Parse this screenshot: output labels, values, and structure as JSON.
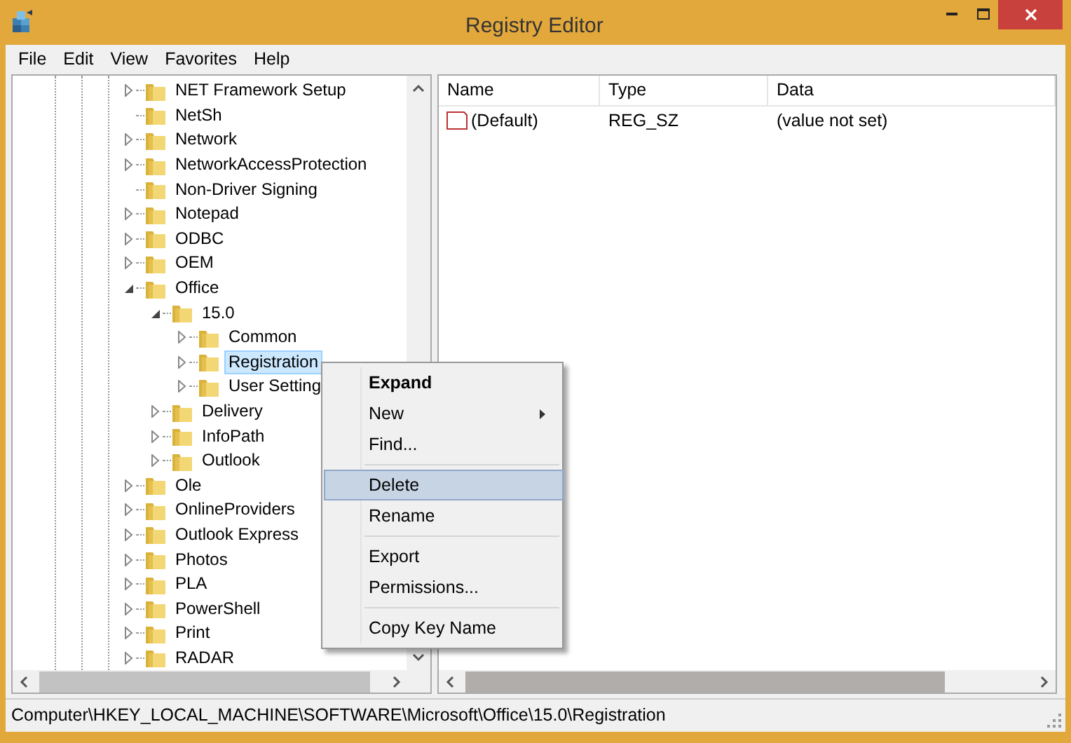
{
  "window": {
    "title": "Registry Editor"
  },
  "menu": [
    "File",
    "Edit",
    "View",
    "Favorites",
    "Help"
  ],
  "tree": [
    {
      "label": "NET Framework Setup",
      "expandable": true,
      "expanded": false,
      "selected": false
    },
    {
      "label": "NetSh",
      "expandable": false,
      "selected": false
    },
    {
      "label": "Network",
      "expandable": true,
      "expanded": false,
      "selected": false
    },
    {
      "label": "NetworkAccessProtection",
      "expandable": true,
      "expanded": false,
      "selected": false
    },
    {
      "label": "Non-Driver Signing",
      "expandable": false,
      "selected": false
    },
    {
      "label": "Notepad",
      "expandable": true,
      "expanded": false,
      "selected": false
    },
    {
      "label": "ODBC",
      "expandable": true,
      "expanded": false,
      "selected": false
    },
    {
      "label": "OEM",
      "expandable": true,
      "expanded": false,
      "selected": false
    },
    {
      "label": "Office",
      "expandable": true,
      "expanded": true,
      "selected": false,
      "children": [
        {
          "label": "15.0",
          "expandable": true,
          "expanded": true,
          "selected": false,
          "children": [
            {
              "label": "Common",
              "expandable": true,
              "expanded": false,
              "selected": false
            },
            {
              "label": "Registration",
              "expandable": true,
              "expanded": false,
              "selected": true
            },
            {
              "label": "User Setting",
              "expandable": true,
              "expanded": false,
              "selected": false
            }
          ]
        },
        {
          "label": "Delivery",
          "expandable": true,
          "expanded": false,
          "selected": false
        },
        {
          "label": "InfoPath",
          "expandable": true,
          "expanded": false,
          "selected": false
        },
        {
          "label": "Outlook",
          "expandable": true,
          "expanded": false,
          "selected": false
        }
      ]
    },
    {
      "label": "Ole",
      "expandable": true,
      "expanded": false,
      "selected": false
    },
    {
      "label": "OnlineProviders",
      "expandable": true,
      "expanded": false,
      "selected": false
    },
    {
      "label": "Outlook Express",
      "expandable": true,
      "expanded": false,
      "selected": false
    },
    {
      "label": "Photos",
      "expandable": true,
      "expanded": false,
      "selected": false
    },
    {
      "label": "PLA",
      "expandable": true,
      "expanded": false,
      "selected": false
    },
    {
      "label": "PowerShell",
      "expandable": true,
      "expanded": false,
      "selected": false
    },
    {
      "label": "Print",
      "expandable": true,
      "expanded": false,
      "selected": false
    },
    {
      "label": "RADAR",
      "expandable": true,
      "expanded": false,
      "selected": false
    }
  ],
  "values": {
    "columns": [
      "Name",
      "Type",
      "Data"
    ],
    "rows": [
      {
        "name": "(Default)",
        "type": "REG_SZ",
        "data": "(value not set)"
      }
    ]
  },
  "context_menu": [
    {
      "kind": "item",
      "label": "Expand",
      "default": true,
      "submenu": false,
      "selected": false
    },
    {
      "kind": "item",
      "label": "New",
      "default": false,
      "submenu": true,
      "selected": false
    },
    {
      "kind": "item",
      "label": "Find...",
      "default": false,
      "submenu": false,
      "selected": false
    },
    {
      "kind": "separator"
    },
    {
      "kind": "item",
      "label": "Delete",
      "default": false,
      "submenu": false,
      "selected": true
    },
    {
      "kind": "item",
      "label": "Rename",
      "default": false,
      "submenu": false,
      "selected": false
    },
    {
      "kind": "separator"
    },
    {
      "kind": "item",
      "label": "Export",
      "default": false,
      "submenu": false,
      "selected": false
    },
    {
      "kind": "item",
      "label": "Permissions...",
      "default": false,
      "submenu": false,
      "selected": false
    },
    {
      "kind": "separator"
    },
    {
      "kind": "item",
      "label": "Copy Key Name",
      "default": false,
      "submenu": false,
      "selected": false
    }
  ],
  "status_bar": "Computer\\HKEY_LOCAL_MACHINE\\SOFTWARE\\Microsoft\\Office\\15.0\\Registration"
}
